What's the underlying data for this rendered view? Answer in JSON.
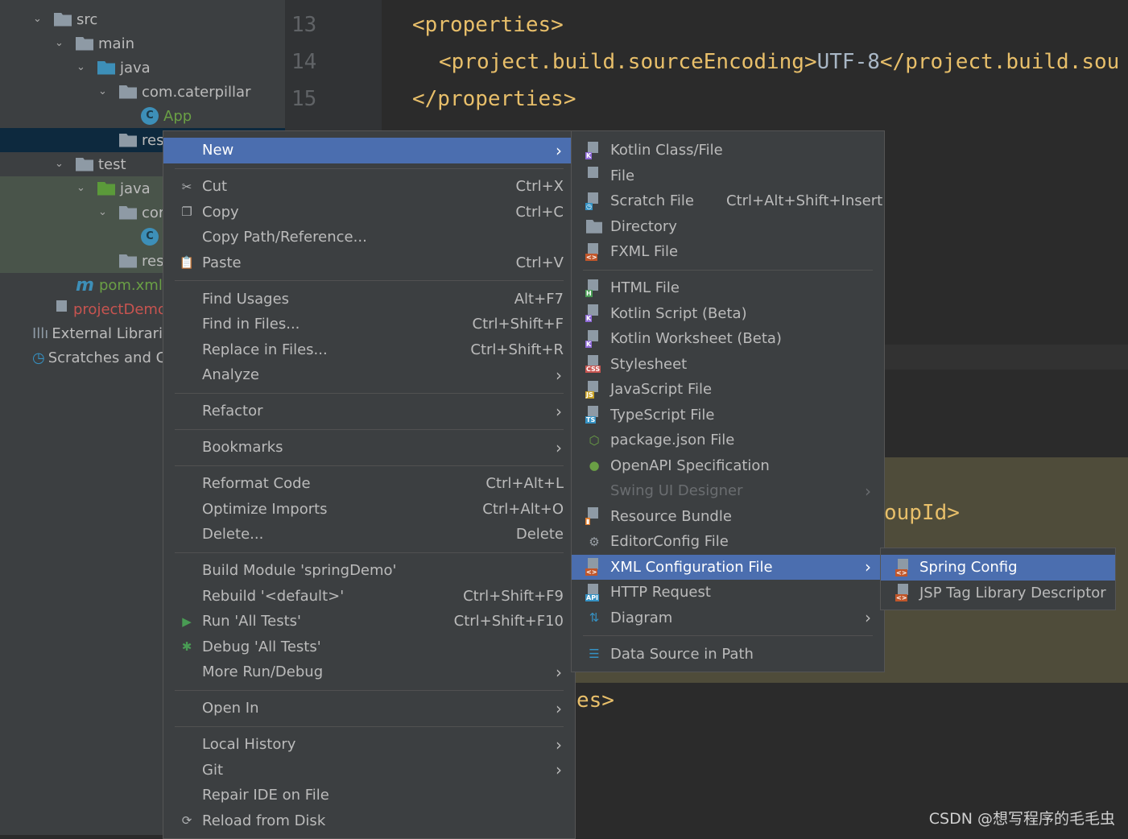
{
  "tree": [
    {
      "label": "src",
      "depth": 1,
      "icon": "folder-icon",
      "chev": true
    },
    {
      "label": "main",
      "depth": 2,
      "icon": "folder-icon",
      "chev": true
    },
    {
      "label": "java",
      "depth": 3,
      "icon": "source-folder-icon",
      "chev": true
    },
    {
      "label": "com.caterpillar",
      "depth": 4,
      "icon": "package-icon",
      "chev": true
    },
    {
      "label": "App",
      "depth": 5,
      "icon": "class-icon",
      "color": "#6a9f45"
    },
    {
      "label": "resour",
      "depth": 4,
      "icon": "resources-folder-icon",
      "selected": true
    },
    {
      "label": "test",
      "depth": 2,
      "icon": "folder-icon",
      "chev": true
    },
    {
      "label": "java",
      "depth": 3,
      "icon": "test-folder-icon",
      "chev": true,
      "test": true
    },
    {
      "label": "cor",
      "depth": 4,
      "icon": "package-icon",
      "chev": true,
      "test": true
    },
    {
      "label": "",
      "depth": 5,
      "icon": "test-class-icon",
      "test": true
    },
    {
      "label": "res",
      "depth": 4,
      "icon": "package-icon",
      "test": true
    },
    {
      "label": "pom.xml",
      "depth": 2,
      "icon": "maven-icon",
      "color": "#6a9f45"
    },
    {
      "label": "projectDemo.im",
      "depth": 1,
      "icon": "iml-file-icon",
      "color": "#c75450"
    },
    {
      "label": "External Libraries",
      "depth": 0,
      "icon": "libraries-icon"
    },
    {
      "label": "Scratches and Cons",
      "depth": 0,
      "icon": "scratches-icon"
    }
  ],
  "editor": {
    "line_numbers": [
      "13",
      "14",
      "15"
    ],
    "lines": [
      {
        "tag": "<properties>",
        "indent": 0
      },
      {
        "tag": "<project.build.sourceEncoding>",
        "text": "UTF-8",
        "close": "</project.build.sou",
        "indent": 1
      },
      {
        "tag": "</properties>",
        "indent": 0
      }
    ],
    "fragment_groupid": "oupId>",
    "fragment_es": "es>"
  },
  "context_menu": [
    {
      "label": "New",
      "arrow": true,
      "highlight": true
    },
    {
      "sep": true
    },
    {
      "label": "Cut",
      "shortcut": "Ctrl+X",
      "icon": "scissors-icon",
      "glyph": "✂"
    },
    {
      "label": "Copy",
      "shortcut": "Ctrl+C",
      "icon": "copy-icon",
      "glyph": "❐"
    },
    {
      "label": "Copy Path/Reference..."
    },
    {
      "label": "Paste",
      "shortcut": "Ctrl+V",
      "icon": "clipboard-icon",
      "glyph": "📋"
    },
    {
      "sep": true
    },
    {
      "label": "Find Usages",
      "shortcut": "Alt+F7"
    },
    {
      "label": "Find in Files...",
      "shortcut": "Ctrl+Shift+F"
    },
    {
      "label": "Replace in Files...",
      "shortcut": "Ctrl+Shift+R"
    },
    {
      "label": "Analyze",
      "arrow": true
    },
    {
      "sep": true
    },
    {
      "label": "Refactor",
      "arrow": true
    },
    {
      "sep": true
    },
    {
      "label": "Bookmarks",
      "arrow": true
    },
    {
      "sep": true
    },
    {
      "label": "Reformat Code",
      "shortcut": "Ctrl+Alt+L"
    },
    {
      "label": "Optimize Imports",
      "shortcut": "Ctrl+Alt+O"
    },
    {
      "label": "Delete...",
      "shortcut": "Delete"
    },
    {
      "sep": true
    },
    {
      "label": "Build Module 'springDemo'"
    },
    {
      "label": "Rebuild '<default>'",
      "shortcut": "Ctrl+Shift+F9"
    },
    {
      "label": "Run 'All Tests'",
      "shortcut": "Ctrl+Shift+F10",
      "icon": "run-icon",
      "glyph": "▶",
      "color": "#499c54"
    },
    {
      "label": "Debug 'All Tests'",
      "icon": "debug-bug-icon",
      "glyph": "✱",
      "color": "#499c54"
    },
    {
      "label": "More Run/Debug",
      "arrow": true
    },
    {
      "sep": true
    },
    {
      "label": "Open In",
      "arrow": true
    },
    {
      "sep": true
    },
    {
      "label": "Local History",
      "arrow": true
    },
    {
      "label": "Git",
      "arrow": true
    },
    {
      "label": "Repair IDE on File"
    },
    {
      "label": "Reload from Disk",
      "icon": "reload-icon",
      "glyph": "⟳"
    }
  ],
  "new_submenu": [
    {
      "label": "Kotlin Class/File",
      "icon": "kotlin-file-icon",
      "badge": "K",
      "badge_color": "#8f6ad8"
    },
    {
      "label": "File",
      "icon": "file-icon"
    },
    {
      "label": "Scratch File",
      "shortcut": "Ctrl+Alt+Shift+Insert",
      "icon": "scratch-file-icon",
      "badge": "◷",
      "badge_color": "#3592c4"
    },
    {
      "label": "Directory",
      "icon": "directory-icon"
    },
    {
      "label": "FXML File",
      "icon": "fxml-file-icon",
      "badge": "<>",
      "badge_color": "#c1562a"
    },
    {
      "sep": true
    },
    {
      "label": "HTML File",
      "icon": "html-file-icon",
      "badge": "H",
      "badge_color": "#499c54"
    },
    {
      "label": "Kotlin Script (Beta)",
      "icon": "kotlin-script-icon",
      "badge": "K",
      "badge_color": "#8f6ad8"
    },
    {
      "label": "Kotlin Worksheet (Beta)",
      "icon": "kotlin-worksheet-icon",
      "badge": "K",
      "badge_color": "#8f6ad8"
    },
    {
      "label": "Stylesheet",
      "icon": "css-file-icon",
      "badge": "CSS",
      "badge_color": "#c75450"
    },
    {
      "label": "JavaScript File",
      "icon": "javascript-file-icon",
      "badge": "JS",
      "badge_color": "#c9a227"
    },
    {
      "label": "TypeScript File",
      "icon": "typescript-file-icon",
      "badge": "TS",
      "badge_color": "#3592c4"
    },
    {
      "label": "package.json File",
      "icon": "nodejs-icon",
      "glyph": "⬡",
      "color": "#6a9f45"
    },
    {
      "label": "OpenAPI Specification",
      "icon": "openapi-icon",
      "glyph": "●",
      "color": "#6a9f45"
    },
    {
      "label": "Swing UI Designer",
      "arrow": true,
      "disabled": true
    },
    {
      "label": "Resource Bundle",
      "icon": "resource-bundle-icon",
      "badge": "▮",
      "badge_color": "#e07b2a"
    },
    {
      "label": "EditorConfig File",
      "icon": "gear-icon",
      "glyph": "⚙",
      "color": "#9aa0a6"
    },
    {
      "label": "XML Configuration File",
      "arrow": true,
      "highlight": true,
      "icon": "xml-file-icon",
      "badge": "<>",
      "badge_color": "#c1562a"
    },
    {
      "label": "HTTP Request",
      "icon": "http-request-icon",
      "badge": "API",
      "badge_color": "#3592c4"
    },
    {
      "label": "Diagram",
      "arrow": true,
      "icon": "diagram-icon",
      "glyph": "⇅",
      "color": "#3592c4"
    },
    {
      "sep": true
    },
    {
      "label": "Data Source in Path",
      "icon": "database-icon",
      "glyph": "☰",
      "color": "#3592c4"
    }
  ],
  "xml_submenu": [
    {
      "label": "Spring Config",
      "highlight": true,
      "icon": "spring-xml-icon",
      "badge": "<>",
      "badge_color": "#c1562a"
    },
    {
      "label": "JSP Tag Library Descriptor",
      "icon": "xml-file-icon",
      "badge": "<>",
      "badge_color": "#c1562a"
    }
  ],
  "watermark": "CSDN @想写程序的毛毛虫"
}
